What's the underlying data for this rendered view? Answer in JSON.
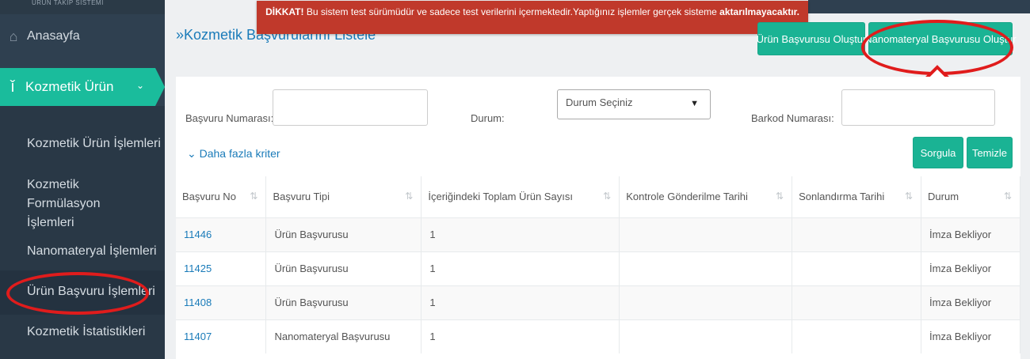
{
  "sidebar": {
    "header": "ÜRÜN TAKİP SİSTEMİ",
    "home_label": "Anasayfa",
    "section_label": "Kozmetik Ürün",
    "items": [
      {
        "label": "Kozmetik Ürün İşlemleri"
      },
      {
        "label": "Kozmetik Formülasyon İşlemleri"
      },
      {
        "label": "Nanomateryal İşlemleri"
      },
      {
        "label": "Ürün Başvuru İşlemleri"
      },
      {
        "label": "Kozmetik İstatistikleri"
      }
    ]
  },
  "warning": {
    "prefix": "DİKKAT!",
    "text": " Bu sistem test sürümüdür ve sadece test verilerini içermektedir.Yaptığınız işlemler gerçek sisteme ",
    "bold_end": "aktarılmayacaktır."
  },
  "page": {
    "title": "»Kozmetik Başvurularını Listele"
  },
  "buttons": {
    "urun_basvurusu": "Ürün Başvurusu Oluştur",
    "nanomateryal_basvurusu": "Nanomateryal Başvurusu Oluştur",
    "sorgula": "Sorgula",
    "temizle": "Temizle"
  },
  "filters": {
    "basvuru_no_label": "Başvuru Numarası:",
    "durum_label": "Durum:",
    "durum_selected": "Durum Seçiniz",
    "barkod_label": "Barkod Numarası:",
    "more_criteria": "Daha fazla kriter"
  },
  "table": {
    "columns": [
      "Başvuru No",
      "Başvuru Tipi",
      "İçeriğindeki Toplam Ürün Sayısı",
      "Kontrole Gönderilme Tarihi",
      "Sonlandırma Tarihi",
      "Durum"
    ],
    "rows": [
      {
        "no": "11446",
        "tip": "Ürün Başvurusu",
        "sayi": "1",
        "kontrol": "",
        "son": "",
        "durum": "İmza Bekliyor"
      },
      {
        "no": "11425",
        "tip": "Ürün Başvurusu",
        "sayi": "1",
        "kontrol": "",
        "son": "",
        "durum": "İmza Bekliyor"
      },
      {
        "no": "11408",
        "tip": "Ürün Başvurusu",
        "sayi": "1",
        "kontrol": "",
        "son": "",
        "durum": "İmza Bekliyor"
      },
      {
        "no": "11407",
        "tip": "Nanomateryal Başvurusu",
        "sayi": "1",
        "kontrol": "",
        "son": "",
        "durum": "İmza Bekliyor"
      }
    ]
  },
  "colors": {
    "sidebar": "#2f4050",
    "accent": "#1ab394",
    "warning": "#c0392b",
    "link": "#1a7bb9",
    "annotation": "#e01c1c"
  },
  "icons": {
    "home": "home-icon",
    "cosmetic": "cosmetic-icon",
    "chevron": "chevron-down-icon",
    "sort": "sort-icon",
    "annotation_arrow": "up-arrow-icon"
  }
}
